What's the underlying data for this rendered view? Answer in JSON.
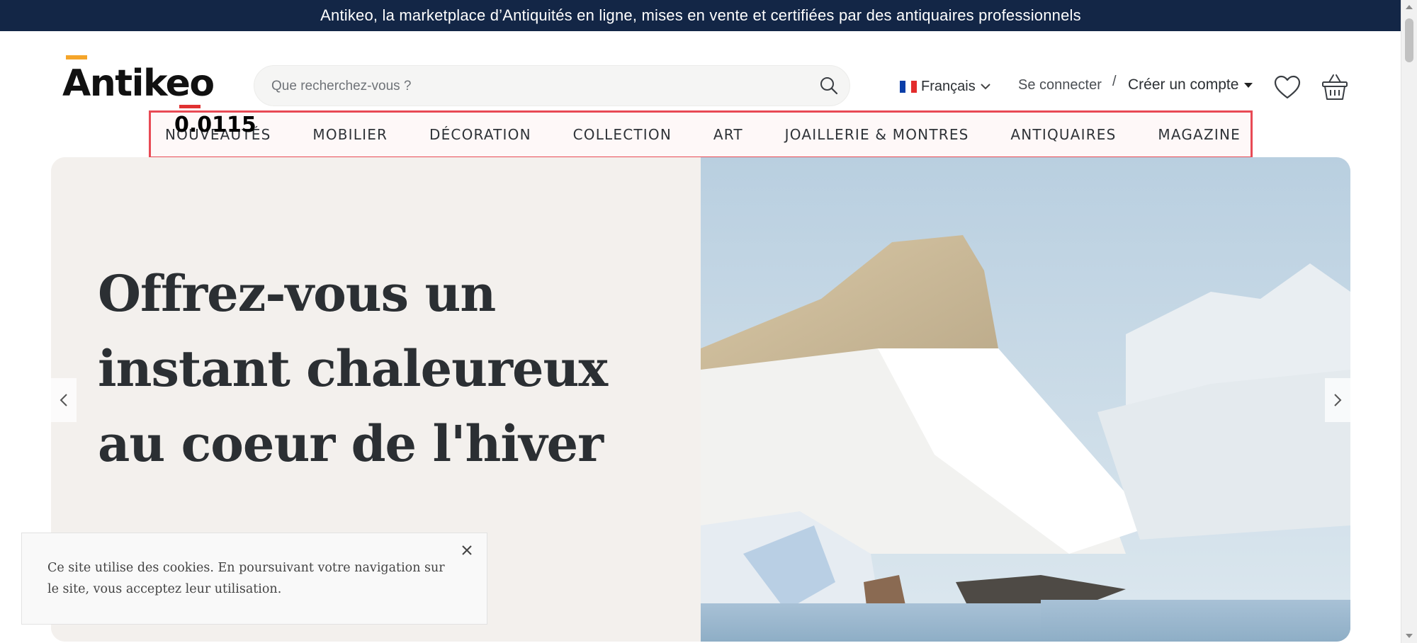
{
  "announcement": "Antikeo, la marketplace d’Antiquités en ligne, mises en vente et certifiées par des antiquaires professionnels",
  "brand": {
    "name": "Antikeo",
    "accent_color": "#f5a52a",
    "dark_color": "#132646"
  },
  "search": {
    "placeholder": "Que recherchez-vous ?"
  },
  "header": {
    "language": "Français",
    "login": "Se connecter",
    "separator": "/",
    "signup": "Créer un compte"
  },
  "nav": {
    "items": [
      {
        "label": "NOUVEAUTÉS"
      },
      {
        "label": "MOBILIER"
      },
      {
        "label": "DÉCORATION"
      },
      {
        "label": "COLLECTION"
      },
      {
        "label": "ART"
      },
      {
        "label": "JOAILLERIE & MONTRES"
      },
      {
        "label": "ANTIQUAIRES"
      },
      {
        "label": "MAGAZINE"
      }
    ],
    "highlight_score": "0.0115",
    "highlight_color": "#e84a55"
  },
  "hero": {
    "title": "Offrez-vous un instant chaleureux au coeur de l'hiver"
  },
  "cookie": {
    "text": "Ce site utilise des cookies. En poursuivant votre navigation sur le site, vous acceptez leur utilisation."
  },
  "icons": [
    "search-icon",
    "heart-icon",
    "basket-icon",
    "chevron-left-icon",
    "chevron-right-icon",
    "close-icon",
    "french-flag-icon"
  ]
}
